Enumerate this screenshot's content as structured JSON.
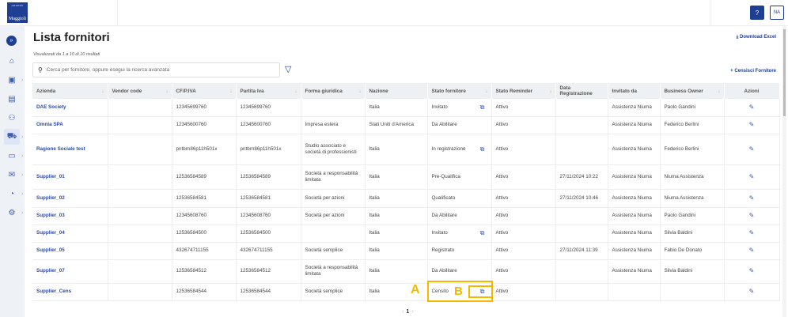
{
  "header": {
    "logo_text": "Maggioli",
    "logo_group": "GRUPPO",
    "help_label": "?",
    "avatar_initials": "NA"
  },
  "sidebar": {
    "items": [
      {
        "name": "expand",
        "icon": "double-chevron-icon"
      },
      {
        "name": "home",
        "icon": "home-icon"
      },
      {
        "name": "anagrafica",
        "icon": "id-card-icon",
        "chevron": true
      },
      {
        "name": "work",
        "icon": "briefcase-icon"
      },
      {
        "name": "users",
        "icon": "people-icon"
      },
      {
        "name": "suppliers",
        "icon": "truck-icon",
        "chevron": true,
        "active": true
      },
      {
        "name": "documents",
        "icon": "folder-icon",
        "chevron": true
      },
      {
        "name": "messages",
        "icon": "mail-icon",
        "chevron": true
      },
      {
        "name": "reports",
        "icon": "globe-icon",
        "chevron": true
      },
      {
        "name": "settings",
        "icon": "gear-icon",
        "chevron": true
      }
    ]
  },
  "page": {
    "title": "Lista fornitori",
    "subtitle": "Visualizzati da 1 a 10 di 10 risultati",
    "search_placeholder": "Cerca per fornitore, oppure esegui la ricerca avanzata",
    "download_label": "Download Excel",
    "add_label": "Censisci Fornitore"
  },
  "table": {
    "columns": [
      "Azienda",
      "Vendor code",
      "CF/P.IVA",
      "Partita Iva",
      "Forma giuridica",
      "Nazione",
      "Stato fornitore",
      "Stato Reminder",
      "Data Registrazione",
      "Invitato da",
      "Business Owner",
      "Azioni"
    ],
    "rows": [
      [
        "DAE Society",
        "",
        "12345699760",
        "12345699760",
        "",
        "Italia",
        "Invitato",
        "Attivo",
        "",
        "Assistenza Niuma",
        "Paolo Gandini"
      ],
      [
        "Omnia SPA",
        "",
        "12345600760",
        "12345600760",
        "Impresa estera",
        "Stati Uniti d'America",
        "Da Abilitare",
        "Attivo",
        "",
        "Assistenza Niuma",
        "Federico Berlini"
      ],
      [
        "Ragione Sociale test",
        "",
        "pntbrn86p11h501x",
        "pntbrn86p11h501x",
        "Studio associato e società di professionisti",
        "Italia",
        "In registrazione",
        "Attivo",
        "",
        "Assistenza Niuma",
        "Federico Berlini"
      ],
      [
        "Supplier_01",
        "",
        "12536584589",
        "12536584589",
        "Società a responsabilità limitata",
        "Italia",
        "Pre-Qualifica",
        "Attivo",
        "27/11/2024 10:22",
        "Assistenza Niuma",
        "Niuma Assistenza"
      ],
      [
        "Supplier_02",
        "",
        "12536584581",
        "12536584581",
        "Società per azioni",
        "Italia",
        "Qualificato",
        "Attivo",
        "27/11/2024 10:46",
        "Assistenza Niuma",
        "Niuma Assistenza"
      ],
      [
        "Supplier_03",
        "",
        "12345608760",
        "12345608760",
        "Società per azioni",
        "Italia",
        "Da Abilitare",
        "Attivo",
        "",
        "Assistenza Niuma",
        "Paolo Gandini"
      ],
      [
        "Supplier_04",
        "",
        "12536584500",
        "12536584500",
        "",
        "Italia",
        "Invitato",
        "Attivo",
        "",
        "Assistenza Niuma",
        "Silvia Baldini"
      ],
      [
        "Supplier_05",
        "",
        "432674711155",
        "432674711155",
        "Società semplice",
        "Italia",
        "Registrato",
        "Attivo",
        "27/11/2024 11:39",
        "Assistenza Niuma",
        "Fabio De Donato"
      ],
      [
        "Supplier_07",
        "",
        "12536584512",
        "12536584512",
        "Società a responsabilità limitata",
        "Italia",
        "Da Abilitare",
        "Attivo",
        "",
        "Assistenza Niuma",
        "Silvia Baldini"
      ],
      [
        "Supplier_Cens",
        "",
        "12536584544",
        "12536584544",
        "Società semplice",
        "Italia",
        "Censito",
        "Attivo",
        "",
        "",
        ""
      ]
    ],
    "external_link_rows": [
      0,
      2,
      6,
      9
    ]
  },
  "pagination": {
    "current": "1"
  },
  "annotations": {
    "a": "A",
    "b": "B",
    "color": "#f5b800"
  }
}
